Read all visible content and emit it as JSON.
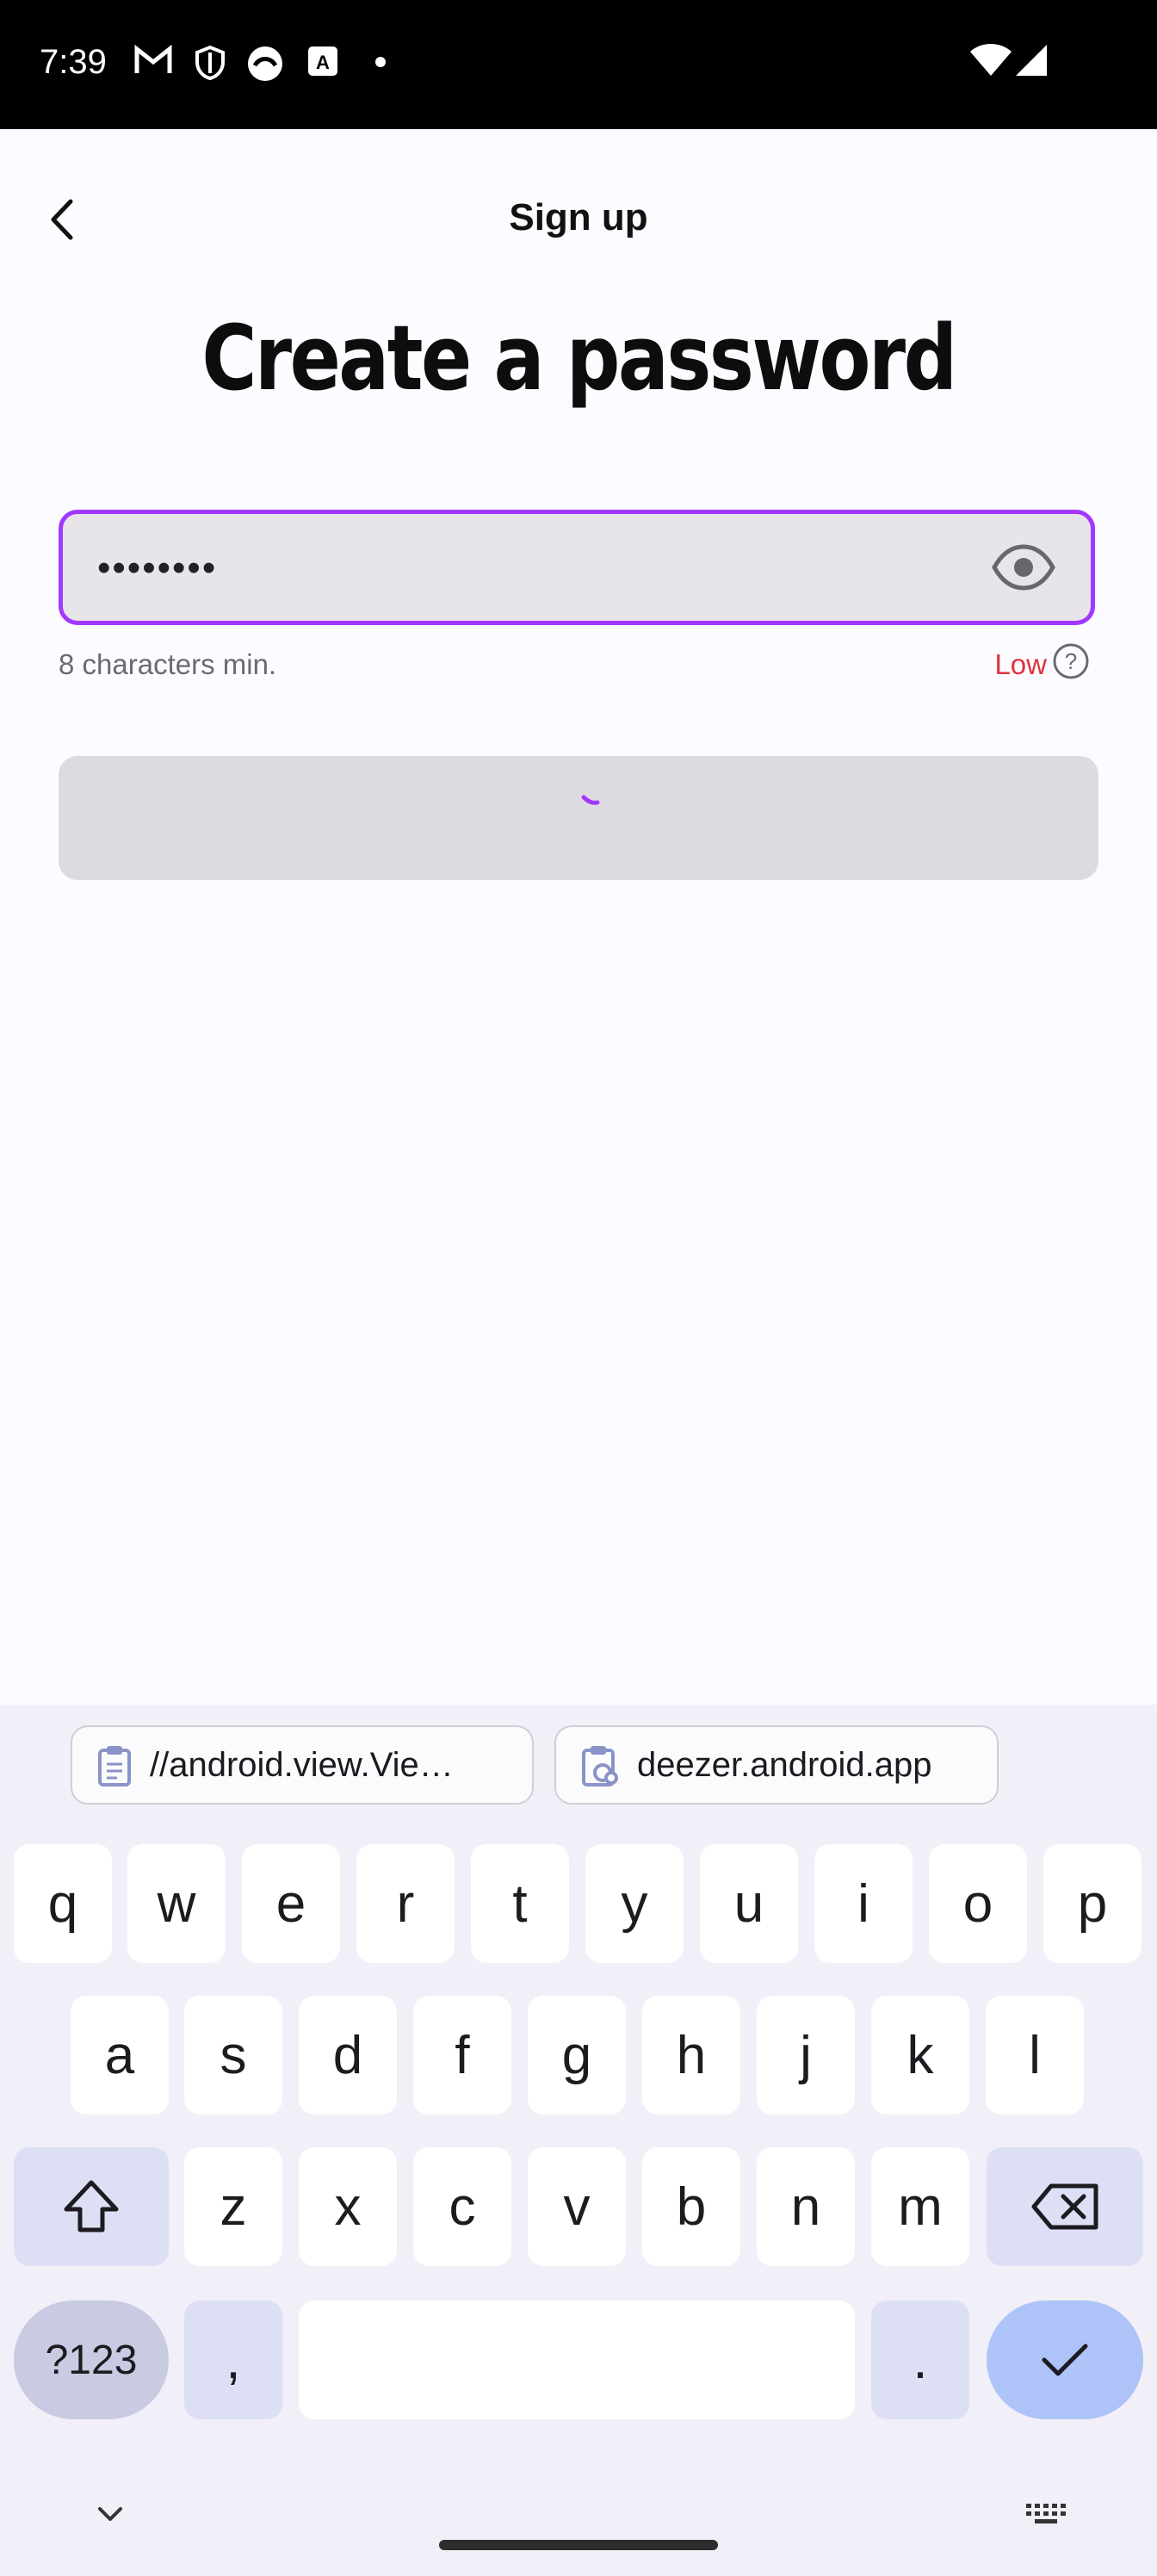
{
  "status_bar": {
    "time": "7:39"
  },
  "app_bar": {
    "title": "Sign up"
  },
  "heading": "Create a password",
  "password": {
    "value": "••••••••",
    "hint": "8 characters min.",
    "strength": "Low"
  },
  "colors": {
    "accent": "#a238ff",
    "error": "#e0323a",
    "field_bg": "#e7e4ea"
  },
  "clipboard": {
    "chip1": "//android.view.Vie…",
    "chip2": "deezer.android.app"
  },
  "keyboard": {
    "row1": [
      "q",
      "w",
      "e",
      "r",
      "t",
      "y",
      "u",
      "i",
      "o",
      "p"
    ],
    "row2": [
      "a",
      "s",
      "d",
      "f",
      "g",
      "h",
      "j",
      "k",
      "l"
    ],
    "row3": [
      "z",
      "x",
      "c",
      "v",
      "b",
      "n",
      "m"
    ],
    "symbols": "?123",
    "comma": ",",
    "period": "."
  }
}
